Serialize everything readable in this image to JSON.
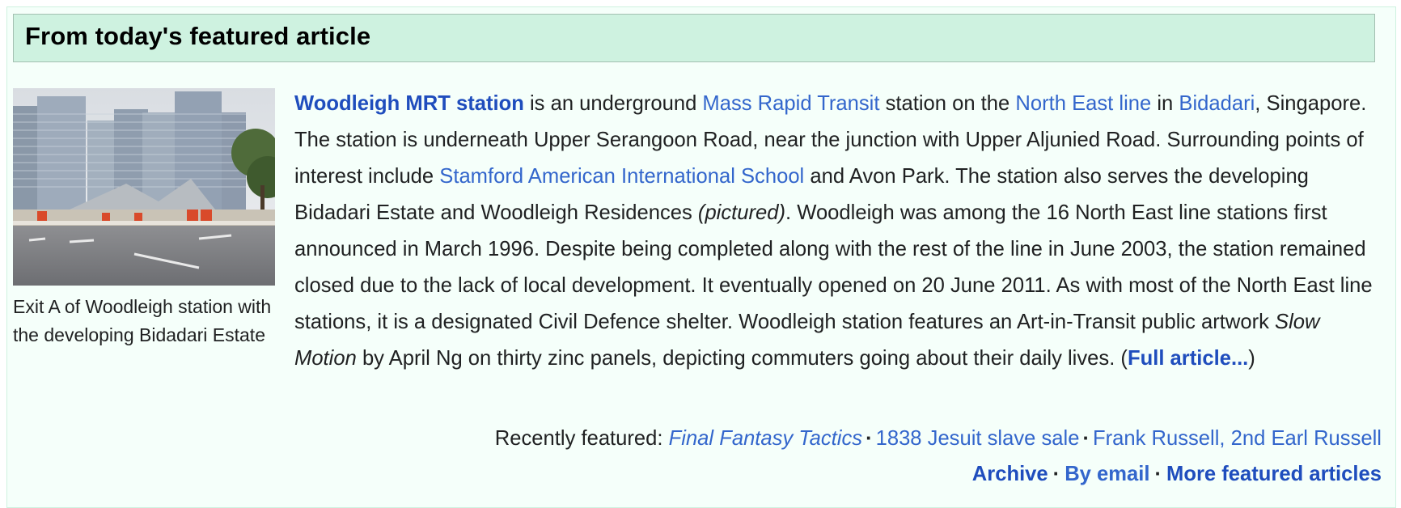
{
  "header": {
    "title": "From today's featured article"
  },
  "image": {
    "caption": "Exit A of Woodleigh station with the developing Bidadari Estate"
  },
  "article": {
    "lead_link": "Woodleigh MRT station",
    "t1": " is an underground ",
    "link_mrt": "Mass Rapid Transit",
    "t2": " station on the ",
    "link_nel": "North East line",
    "t3": " in ",
    "link_bidadari": "Bidadari",
    "t4": ", Singapore. The station is underneath Upper Serangoon Road, near the junction with Upper Aljunied Road. Surrounding points of interest include ",
    "link_school": "Stamford American International School",
    "t5": " and Avon Park. The station also serves the developing Bidadari Estate and Woodleigh Residences ",
    "pictured": "(pictured)",
    "t6": ". Woodleigh was among the 16 North East line stations first announced in March 1996. Despite being completed along with the rest of the line in June 2003, the station remained closed due to the lack of local development. It eventually opened on 20 June 2011. As with most of the North East line stations, it is a designated Civil Defence shelter. Woodleigh station features an Art-in-Transit public artwork ",
    "artwork": "Slow Motion",
    "t7": " by April Ng on thirty zinc panels, depicting commuters going about their daily lives. (",
    "full_article": "Full article...",
    "t8": ")"
  },
  "recently_featured": {
    "label": "Recently featured: ",
    "items": [
      "Final Fantasy Tactics",
      "1838 Jesuit slave sale",
      "Frank Russell, 2nd Earl Russell"
    ],
    "separator": "·"
  },
  "footer": {
    "archive": "Archive",
    "by_email": "By email",
    "more": "More featured articles",
    "separator": "·"
  },
  "colors": {
    "panel_bg": "#f5fffa",
    "header_bg": "#cef2e0",
    "header_border": "#a3bfb1",
    "link": "#3366cc",
    "text": "#202122"
  }
}
